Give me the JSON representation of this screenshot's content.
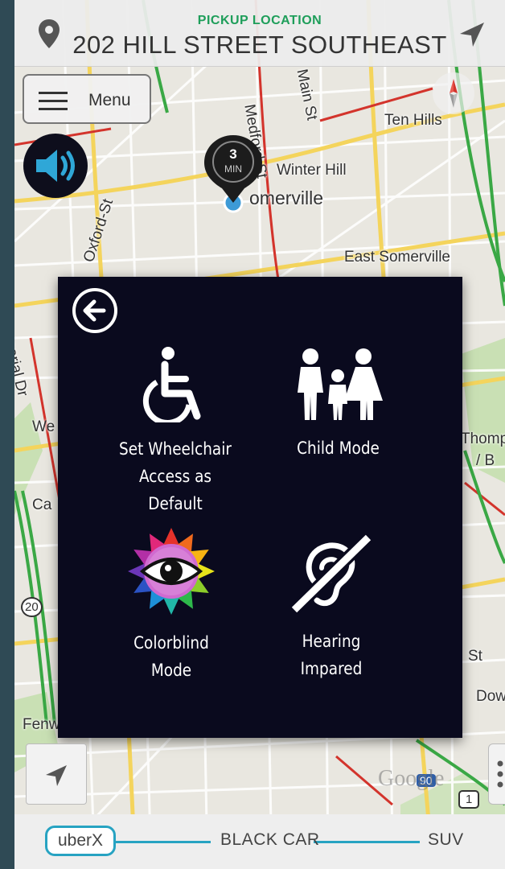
{
  "header": {
    "pickup_label": "PICKUP LOCATION",
    "address": "202 HILL STREET SOUTHEAST"
  },
  "menu": {
    "label": "Menu"
  },
  "map": {
    "eta_value": "3",
    "eta_unit": "MIN",
    "labels": {
      "medford_st": "Medford St",
      "main_st": "Main St",
      "ten_hills": "Ten Hills",
      "winter_hill": "Winter Hill",
      "somerville": "omerville",
      "oxford_st": "Oxford-St",
      "east_somerville": "East Somerville",
      "memorial_dr": "morial Dr",
      "we": "We",
      "thomp": "Thomp",
      "b": "/ B",
      "ca": "Ca",
      "st": "St",
      "dow": "Dow",
      "fenw": "Fenw",
      "route_20": "20",
      "route_1": "1",
      "route_90": "90",
      "faded_top": "Winter Hill"
    },
    "google": "Google"
  },
  "accessibility_panel": {
    "options": {
      "wheelchair": {
        "line1": "Set Wheelchair",
        "line2": "Access as Default"
      },
      "child": {
        "line1": "Child Mode"
      },
      "colorblind": {
        "line1": "Colorblind",
        "line2": "Mode"
      },
      "hearing": {
        "line1": "Hearing",
        "line2": "Impared"
      }
    }
  },
  "vehicle_selector": {
    "selected": "uberX",
    "options": [
      "BLACK CAR",
      "SUV"
    ]
  },
  "colors": {
    "accent": "#27a3c2",
    "pickup_green": "#1e9e5a",
    "panel_bg": "#0a0a1e"
  }
}
